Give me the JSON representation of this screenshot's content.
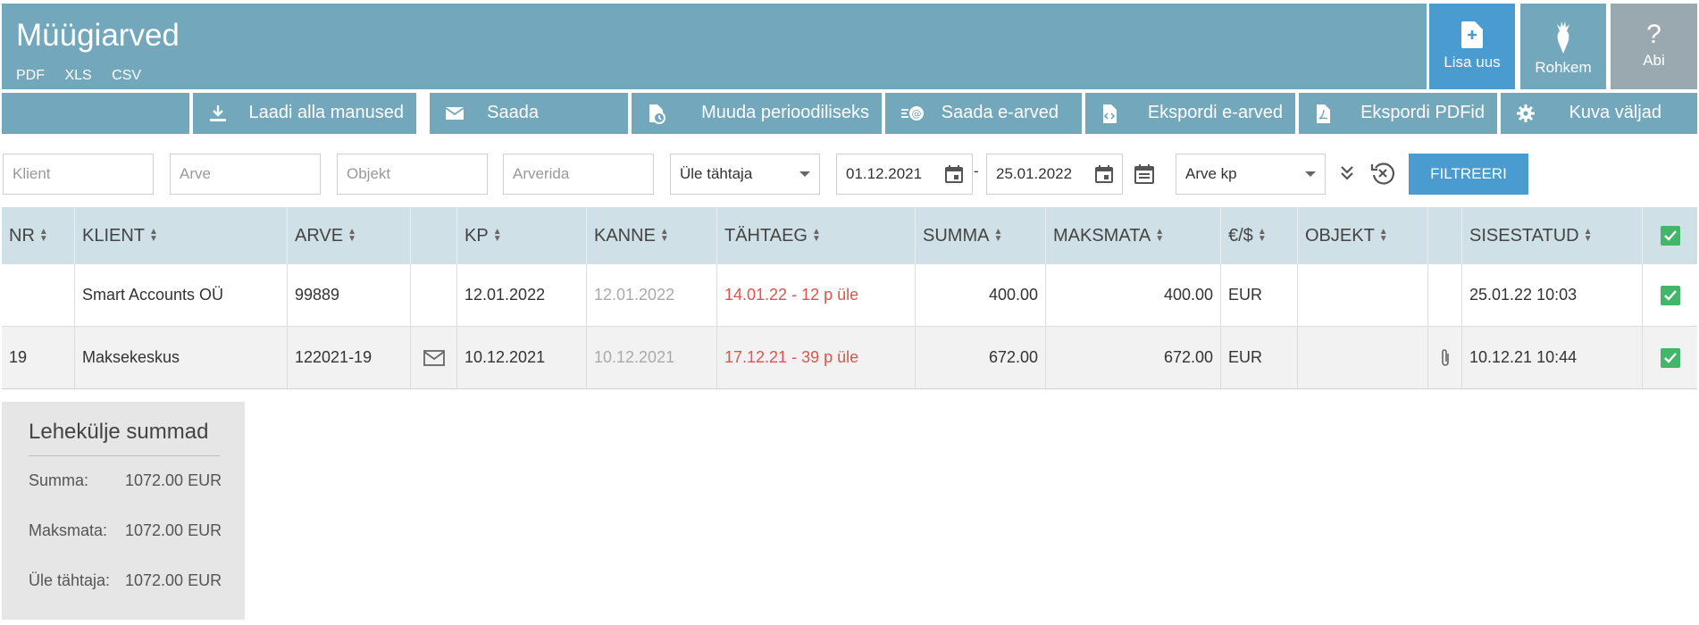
{
  "header": {
    "title": "Müügiarved",
    "exports": [
      "PDF",
      "XLS",
      "CSV"
    ],
    "buttons": {
      "new": "Lisa uus",
      "more": "Rohkem",
      "help": "Abi"
    }
  },
  "toolbar": {
    "download": "Laadi alla manused",
    "send": "Saada",
    "periodic": "Muuda perioodiliseks",
    "send_einvoice": "Saada e-arved",
    "export_einvoice": "Ekspordi e-arved",
    "export_pdf": "Ekspordi PDFid",
    "show_fields": "Kuva väljad"
  },
  "filters": {
    "client_placeholder": "Klient",
    "invoice_placeholder": "Arve",
    "object_placeholder": "Objekt",
    "rows_placeholder": "Arverida",
    "status_value": "Üle tähtaja",
    "date_from": "01.12.2021",
    "date_separator": "-",
    "date_to": "25.01.2022",
    "date_field_value": "Arve kp",
    "filter_button": "FILTREERI"
  },
  "table": {
    "columns": {
      "nr": "NR",
      "client": "KLIENT",
      "invoice": "ARVE",
      "kp": "KP",
      "entry": "KANNE",
      "due": "TÄHTAEG",
      "sum": "SUMMA",
      "unpaid": "MAKSMATA",
      "currency": "€/$",
      "object": "OBJEKT",
      "entered": "SISESTATUD"
    },
    "rows": [
      {
        "nr": "",
        "client": "Smart Accounts OÜ",
        "invoice": "99889",
        "kp": "12.01.2022",
        "entry": "12.01.2022",
        "due": "14.01.22 - 12 p üle",
        "sum": "400.00",
        "unpaid": "400.00",
        "currency": "EUR",
        "object": "",
        "entered": "25.01.22 10:03"
      },
      {
        "nr": "19",
        "client": "Maksekeskus",
        "invoice": "122021-19",
        "kp": "10.12.2021",
        "entry": "10.12.2021",
        "due": "17.12.21 - 39 p üle",
        "sum": "672.00",
        "unpaid": "672.00",
        "currency": "EUR",
        "object": "",
        "entered": "10.12.21 10:44"
      }
    ]
  },
  "summary": {
    "title": "Lehekülje summad",
    "sum_label": "Summa:",
    "sum_value": "1072.00 EUR",
    "unpaid_label": "Maksmata:",
    "unpaid_value": "1072.00 EUR",
    "overdue_label": "Üle tähtaja:",
    "overdue_value": "1072.00 EUR"
  },
  "colors": {
    "header": "#72a7bc",
    "accent": "#4a9bcf",
    "overdue": "#e2534a",
    "check": "#43b66a"
  }
}
